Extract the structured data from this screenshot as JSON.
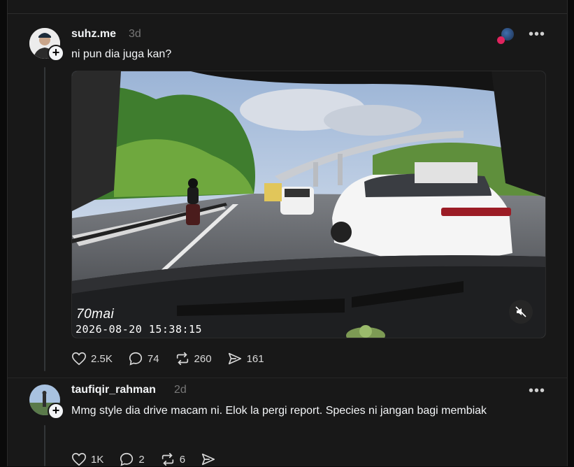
{
  "posts": [
    {
      "username": "suhz.me",
      "time": "3d",
      "text": "ni pun dia juga kan?",
      "video": {
        "brand": "70mai",
        "timestamp": "2026-08-20 15:38:15"
      },
      "actions": {
        "likes": "2.5K",
        "replies": "74",
        "reposts": "260",
        "shares": "161"
      }
    },
    {
      "username": "taufiqir_rahman",
      "time": "2d",
      "text": "Mmg style dia drive macam ni. Elok la pergi report. Species ni jangan bagi membiak",
      "actions": {
        "likes": "1K",
        "replies": "2",
        "reposts": "6",
        "shares": ""
      }
    }
  ],
  "colors": {
    "background": "#181818",
    "text": "#f3f5f7",
    "muted": "#777777",
    "notification_dot": "#e0245e"
  }
}
